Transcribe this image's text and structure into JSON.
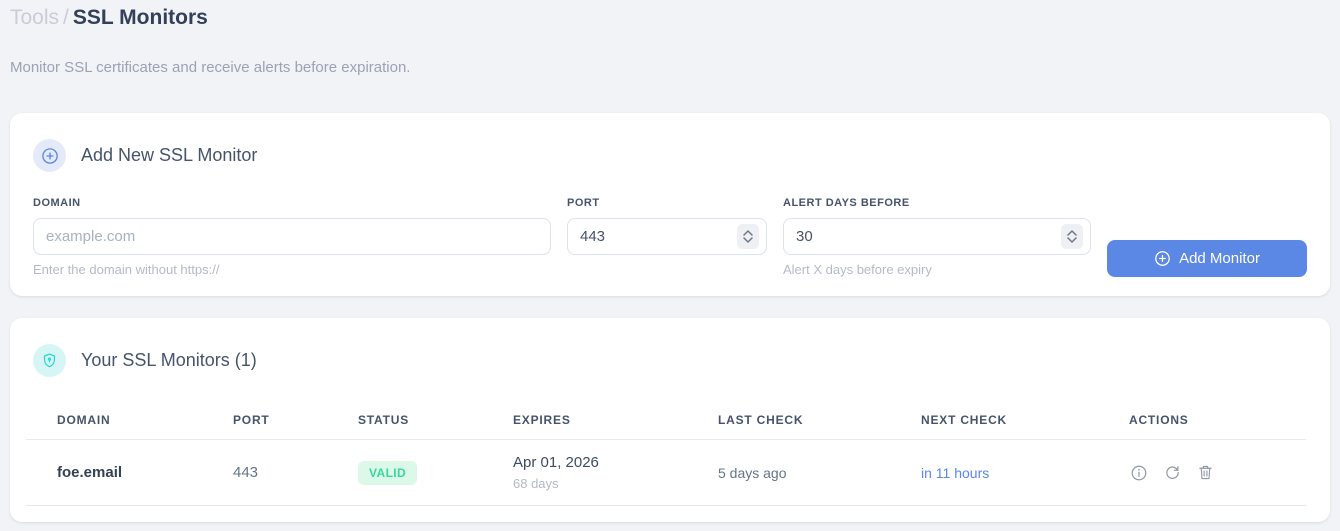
{
  "page": {
    "breadcrumb": {
      "section": "Tools",
      "separator": "/",
      "current": "SSL Monitors"
    },
    "subtitle": "Monitor SSL certificates and receive alerts before expiration."
  },
  "add_form": {
    "title": "Add New SSL Monitor",
    "fields": {
      "domain": {
        "label": "DOMAIN",
        "placeholder": "example.com",
        "value": "",
        "helper": "Enter the domain without https://"
      },
      "port": {
        "label": "PORT",
        "value": "443"
      },
      "alert_days": {
        "label": "ALERT DAYS BEFORE",
        "value": "30",
        "helper": "Alert X days before expiry"
      }
    },
    "submit_label": "Add Monitor"
  },
  "monitors": {
    "title": "Your SSL Monitors (1)",
    "count": 1,
    "table": {
      "headers": [
        "DOMAIN",
        "PORT",
        "STATUS",
        "EXPIRES",
        "LAST CHECK",
        "NEXT CHECK",
        "ACTIONS"
      ],
      "rows": [
        {
          "domain": "foe.email",
          "port": "443",
          "status": "VALID",
          "expires_date": "Apr 01, 2026",
          "expires_days": "68 days",
          "last_check": "5 days ago",
          "next_check": "in 11 hours"
        }
      ]
    }
  },
  "icons": {
    "add_header": "plus-circle-icon",
    "list_header": "shield-lock-icon",
    "submit": "plus-circle-icon",
    "row_actions": [
      "info-icon",
      "refresh-icon",
      "trash-icon"
    ]
  },
  "colors": {
    "accent_blue": "#5b87e5",
    "badge_green_bg": "#dcf8e9",
    "badge_green_text": "#35d9a0",
    "shield_cyan": "#2fd5d0",
    "page_bg": "#f2f3f6",
    "card_bg": "#ffffff"
  }
}
